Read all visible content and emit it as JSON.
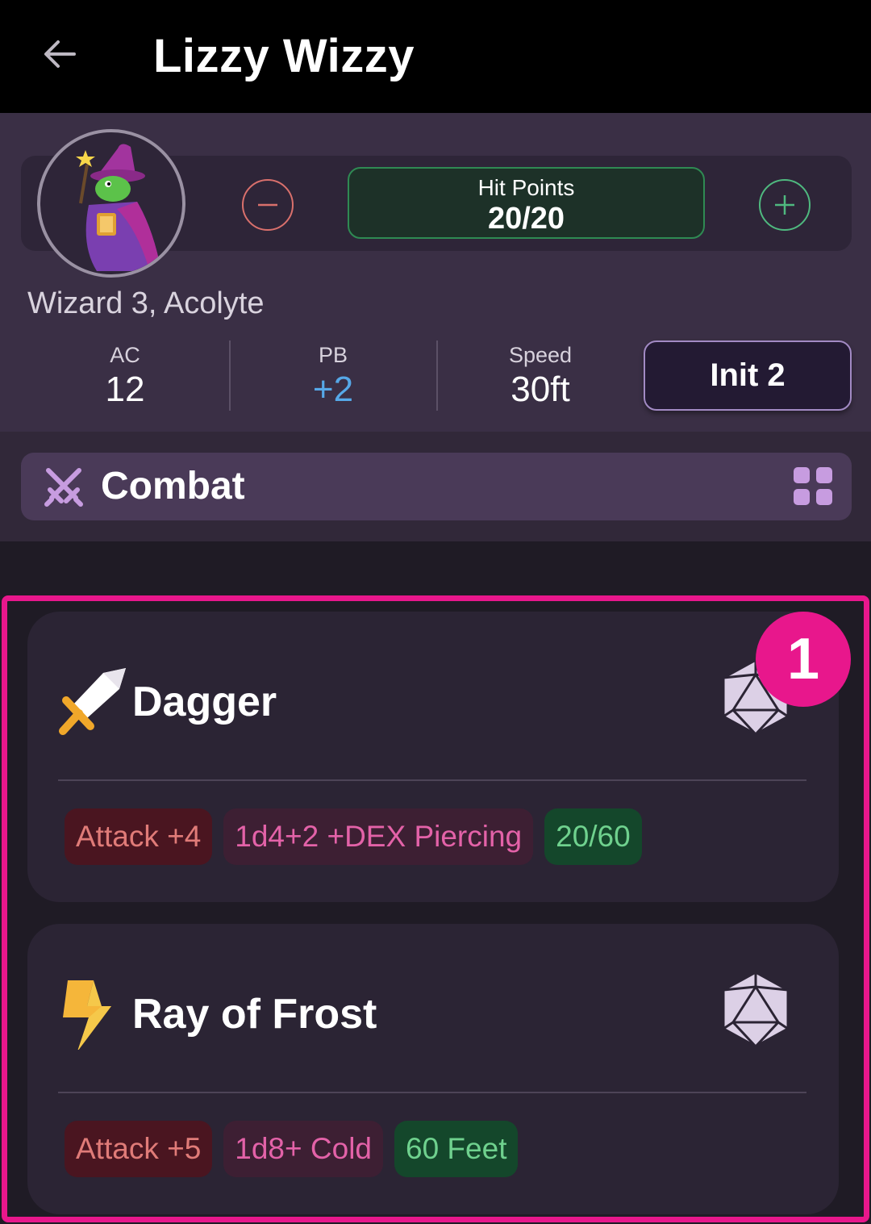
{
  "app": {
    "title": "Lizzy Wizzy",
    "back_icon": "arrow-left-icon"
  },
  "character": {
    "subtitle": "Wizard 3, Acolyte",
    "hit_points": {
      "label": "Hit Points",
      "value": "20/20"
    },
    "stats": [
      {
        "label": "AC",
        "value": "12"
      },
      {
        "label": "PB",
        "value": "+2"
      },
      {
        "label": "Speed",
        "value": "30ft"
      }
    ],
    "init_button": "Init 2"
  },
  "section": {
    "title": "Combat",
    "icon": "crossed-swords-icon",
    "view_icon": "grid-view-icon"
  },
  "actions": [
    {
      "name": "Dagger",
      "icon": "dagger-icon",
      "attack": "Attack +4",
      "damage": "1d4+2 +DEX Piercing",
      "range": "20/60"
    },
    {
      "name": "Ray of Frost",
      "icon": "lightning-icon",
      "attack": "Attack +5",
      "damage": "1d8+ Cold",
      "range": "60 Feet"
    }
  ],
  "annotation": {
    "badge": "1"
  },
  "colors": {
    "accent": "#e8178c",
    "header_bg": "#3a2f45",
    "card_bg": "#2b2434",
    "hp_border": "#2f8a53",
    "attack_chip": "#4a1520",
    "damage_chip": "#3d1f33",
    "range_chip": "#14472b"
  }
}
